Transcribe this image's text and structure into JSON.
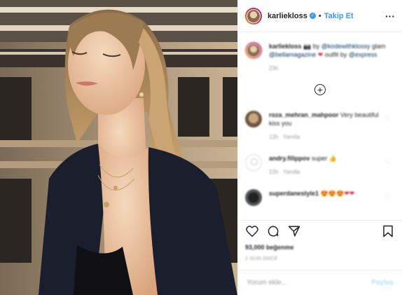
{
  "header": {
    "username": "karliekloss",
    "verified_mark": "✓",
    "separator": "•",
    "follow_label": "Takip Et",
    "more_label": "···"
  },
  "caption": {
    "username": "karliekloss",
    "text_1": "📷 by",
    "mention_1": "@kodewithklossy",
    "text_2": "glam",
    "mention_2": "@bellamagazine",
    "text_3": "outfit by",
    "mention_3": "@express",
    "time": "23h"
  },
  "load_more_label": "+",
  "comments": [
    {
      "username": "roza_mehran_mahpoor",
      "text": "Very beautiful kiss you",
      "time": "12h",
      "reply": "Yanıtla"
    },
    {
      "username": "andry.filippov",
      "text": "super",
      "time": "22h",
      "reply": "Yanıtla"
    },
    {
      "username": "superdanestyle1",
      "text": ""
    }
  ],
  "likes_text": "93,000 beğenme",
  "date_text": "2 GÜN ÖNCE",
  "add_comment": {
    "placeholder": "Yorum ekle...",
    "share_label": "Paylaş"
  },
  "icons": [
    "verified-badge-icon",
    "more-options-icon",
    "heart-icon",
    "comment-icon",
    "share-icon",
    "save-icon",
    "load-more-icon"
  ],
  "colors": {
    "accent": "#3897f0",
    "text": "#262626",
    "muted": "#999999"
  }
}
